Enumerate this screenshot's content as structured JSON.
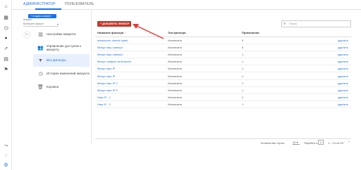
{
  "tabs": {
    "admin": "АДМИНИСТРАТОР",
    "user": "ПОЛЬЗОВАТЕЛЬ"
  },
  "account": {
    "label": "Аккаунт",
    "create_button": "+ Создать аккаунт",
    "select_placeholder": "Выберите аккаунт"
  },
  "nav": {
    "items": [
      {
        "label": "Настройки аккаунта",
        "icon": "building-icon"
      },
      {
        "label": "Управление доступом к аккаунту",
        "icon": "users-icon"
      },
      {
        "label": "Все фильтры",
        "icon": "filter-icon"
      },
      {
        "label": "История изменений аккаунта",
        "icon": "history-icon"
      },
      {
        "label": "Корзина",
        "icon": "trash-icon"
      }
    ]
  },
  "toolbar": {
    "add_filter": "+ ДОБАВИТЬ ФИЛЬТР",
    "search_placeholder": "Поиск"
  },
  "table": {
    "headers": [
      "Название фильтра",
      "Тип фильтра",
      "Примечания"
    ],
    "rows": [
      {
        "name": "исключить utmost spam",
        "type": "Исключить",
        "notes": "0",
        "action": "удалить"
      },
      {
        "name": "Минус наш саппорт",
        "type": "Исключить",
        "notes": "0",
        "action": "удалить"
      },
      {
        "name": "Минус наш саппорт",
        "type": "Исключить",
        "notes": "1",
        "action": "удалить"
      },
      {
        "name": "Минус трафик на биллинг",
        "type": "Исключить",
        "notes": "1",
        "action": "удалить"
      },
      {
        "name": "Минус наш IP",
        "type": "Исключить",
        "notes": "1",
        "action": "удалить"
      },
      {
        "name": "Минус наш IP",
        "type": "Исключить",
        "notes": "1",
        "action": "удалить"
      },
      {
        "name": "Минус наш IP 2",
        "type": "Исключить",
        "notes": "1",
        "action": "удалить"
      },
      {
        "name": "Минус наш IP 3",
        "type": "Исключить",
        "notes": "1",
        "action": "удалить"
      },
      {
        "name": "Наш IP - 1",
        "type": "Исключить",
        "notes": "2",
        "action": "удалить"
      },
      {
        "name": "Наш IP - 2",
        "type": "Исключить",
        "notes": "1",
        "action": "удалить"
      }
    ]
  },
  "pager": {
    "rows_per_page_label": "Количество строк:",
    "rows_per_page": "10",
    "goto_label": "Перейти к:",
    "goto_value": "1",
    "range": "1 – 10 из 25"
  }
}
